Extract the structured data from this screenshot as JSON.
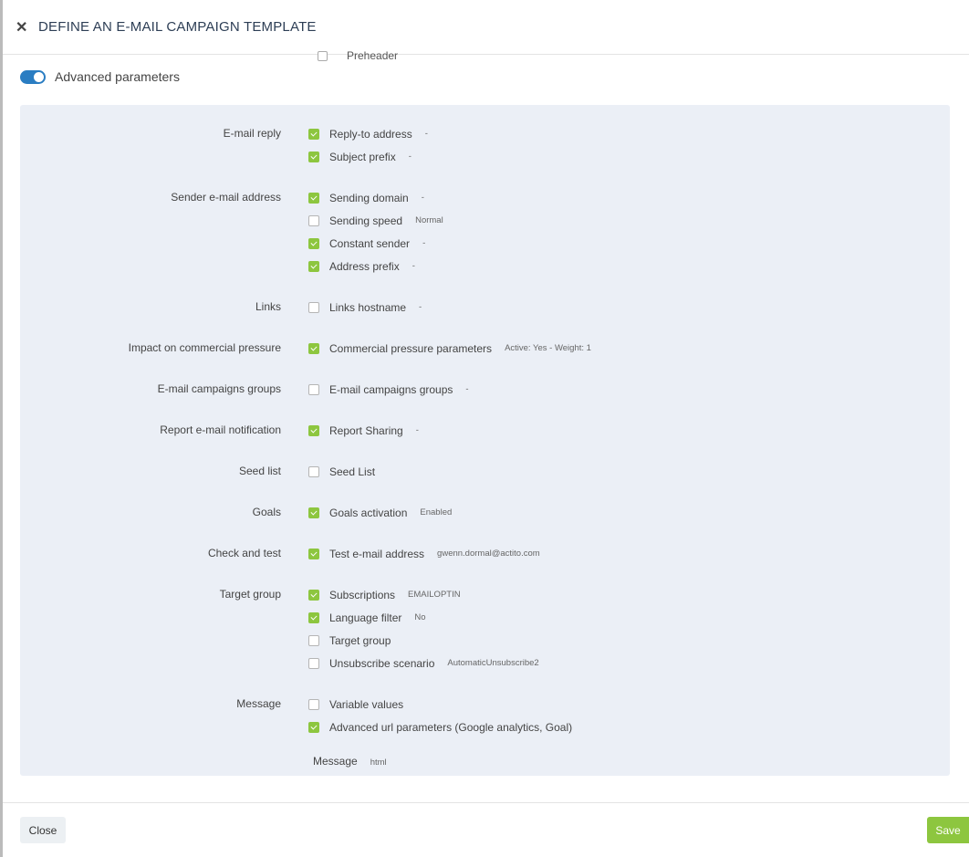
{
  "header": {
    "title": "DEFINE AN E-MAIL CAMPAIGN TEMPLATE"
  },
  "preheader": {
    "label": "Preheader",
    "checked": false
  },
  "advanced": {
    "label": "Advanced parameters",
    "enabled": true
  },
  "groups": [
    {
      "label": "E-mail reply",
      "items": [
        {
          "label": "Reply-to address",
          "checked": true,
          "detail": "-"
        },
        {
          "label": "Subject prefix",
          "checked": true,
          "detail": "-"
        }
      ]
    },
    {
      "label": "Sender e-mail address",
      "items": [
        {
          "label": "Sending domain",
          "checked": true,
          "detail": "-"
        },
        {
          "label": "Sending speed",
          "checked": false,
          "detail": "Normal"
        },
        {
          "label": "Constant sender",
          "checked": true,
          "detail": "-"
        },
        {
          "label": "Address prefix",
          "checked": true,
          "detail": "-"
        }
      ]
    },
    {
      "label": "Links",
      "items": [
        {
          "label": "Links hostname",
          "checked": false,
          "detail": "-"
        }
      ]
    },
    {
      "label": "Impact on commercial pressure",
      "items": [
        {
          "label": "Commercial pressure parameters",
          "checked": true,
          "detail": "Active: Yes - Weight: 1"
        }
      ]
    },
    {
      "label": "E-mail campaigns groups",
      "items": [
        {
          "label": "E-mail campaigns groups",
          "checked": false,
          "detail": "-"
        }
      ]
    },
    {
      "label": "Report e-mail notification",
      "items": [
        {
          "label": "Report Sharing",
          "checked": true,
          "detail": "-"
        }
      ]
    },
    {
      "label": "Seed list",
      "items": [
        {
          "label": "Seed List",
          "checked": false,
          "detail": ""
        }
      ]
    },
    {
      "label": "Goals",
      "items": [
        {
          "label": "Goals activation",
          "checked": true,
          "detail": "Enabled"
        }
      ]
    },
    {
      "label": "Check and test",
      "items": [
        {
          "label": "Test e-mail address",
          "checked": true,
          "detail": "gwenn.dormal@actito.com"
        }
      ]
    },
    {
      "label": "Target group",
      "items": [
        {
          "label": "Subscriptions",
          "checked": true,
          "detail": "EMAILOPTIN"
        },
        {
          "label": "Language filter",
          "checked": true,
          "detail": "No"
        },
        {
          "label": "Target group",
          "checked": false,
          "detail": ""
        },
        {
          "label": "Unsubscribe scenario",
          "checked": false,
          "detail": "AutomaticUnsubscribe2"
        }
      ]
    },
    {
      "label": "Message",
      "items": [
        {
          "label": "Variable values",
          "checked": false,
          "detail": ""
        },
        {
          "label": "Advanced url parameters (Google analytics, Goal)",
          "checked": true,
          "detail": ""
        }
      ],
      "extra": {
        "label": "Message",
        "detail": "html"
      }
    }
  ],
  "footer": {
    "close_label": "Close",
    "save_label": "Save"
  },
  "colors": {
    "accent_green": "#8dc63f",
    "toggle_blue": "#2a7dc2",
    "panel_bg": "#ebeff6"
  }
}
